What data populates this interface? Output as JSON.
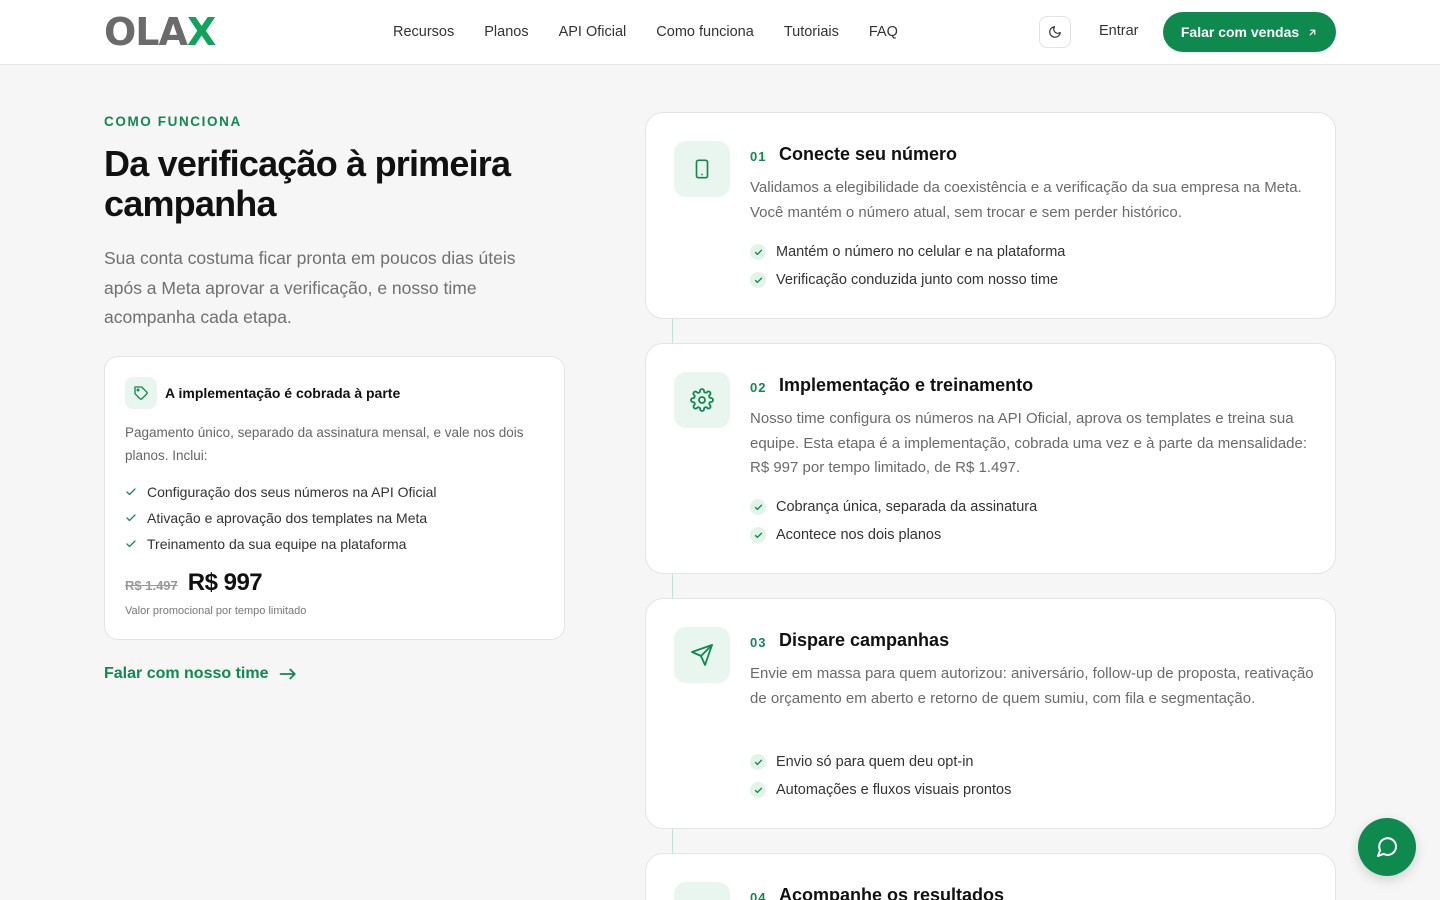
{
  "header": {
    "logo_main": "OLA",
    "logo_accent": "X",
    "nav": [
      "Recursos",
      "Planos",
      "API Oficial",
      "Como funciona",
      "Tutoriais",
      "FAQ"
    ],
    "login": "Entrar",
    "cta": "Falar com vendas"
  },
  "hero": {
    "eyebrow": "COMO FUNCIONA",
    "title": "Da verificação à primeira campanha",
    "subtitle": "Sua conta costuma ficar pronta em poucos dias úteis após a Meta aprovar a verificação, e nosso time acompanha cada etapa."
  },
  "price_card": {
    "title": "A implementação é cobrada à parte",
    "description": "Pagamento único, separado da assinatura mensal, e vale nos dois planos. Inclui:",
    "items": [
      "Configuração dos seus números na API Oficial",
      "Ativação e aprovação dos templates na Meta",
      "Treinamento da sua equipe na plataforma"
    ],
    "old_price": "R$ 1.497",
    "new_price": "R$ 997",
    "note": "Valor promocional por tempo limitado"
  },
  "talk_link": "Falar com nosso time",
  "steps": [
    {
      "num": "01",
      "title": "Conecte seu número",
      "description": "Validamos a elegibilidade da coexistência e a verificação da sua empresa na Meta. Você mantém o número atual, sem trocar e sem perder histórico.",
      "items": [
        "Mantém o número no celular e na plataforma",
        "Verificação conduzida junto com nosso time"
      ]
    },
    {
      "num": "02",
      "title": "Implementação e treinamento",
      "description": "Nosso time configura os números na API Oficial, aprova os templates e treina sua equipe. Esta etapa é a implementação, cobrada uma vez e à parte da mensalidade: R$ 997 por tempo limitado, de R$ 1.497.",
      "items": [
        "Cobrança única, separada da assinatura",
        "Acontece nos dois planos"
      ]
    },
    {
      "num": "03",
      "title": "Dispare campanhas",
      "description": "Envie em massa para quem autorizou: aniversário, follow-up de proposta, reativação de orçamento em aberto e retorno de quem sumiu, com fila e segmentação.",
      "items": [
        "Envio só para quem deu opt-in",
        "Automações e fluxos visuais prontos"
      ]
    },
    {
      "num": "04",
      "title": "Acompanhe os resultados"
    }
  ],
  "colors": {
    "brand": "#0e8a4e",
    "brand_light": "#e9f6ef"
  }
}
